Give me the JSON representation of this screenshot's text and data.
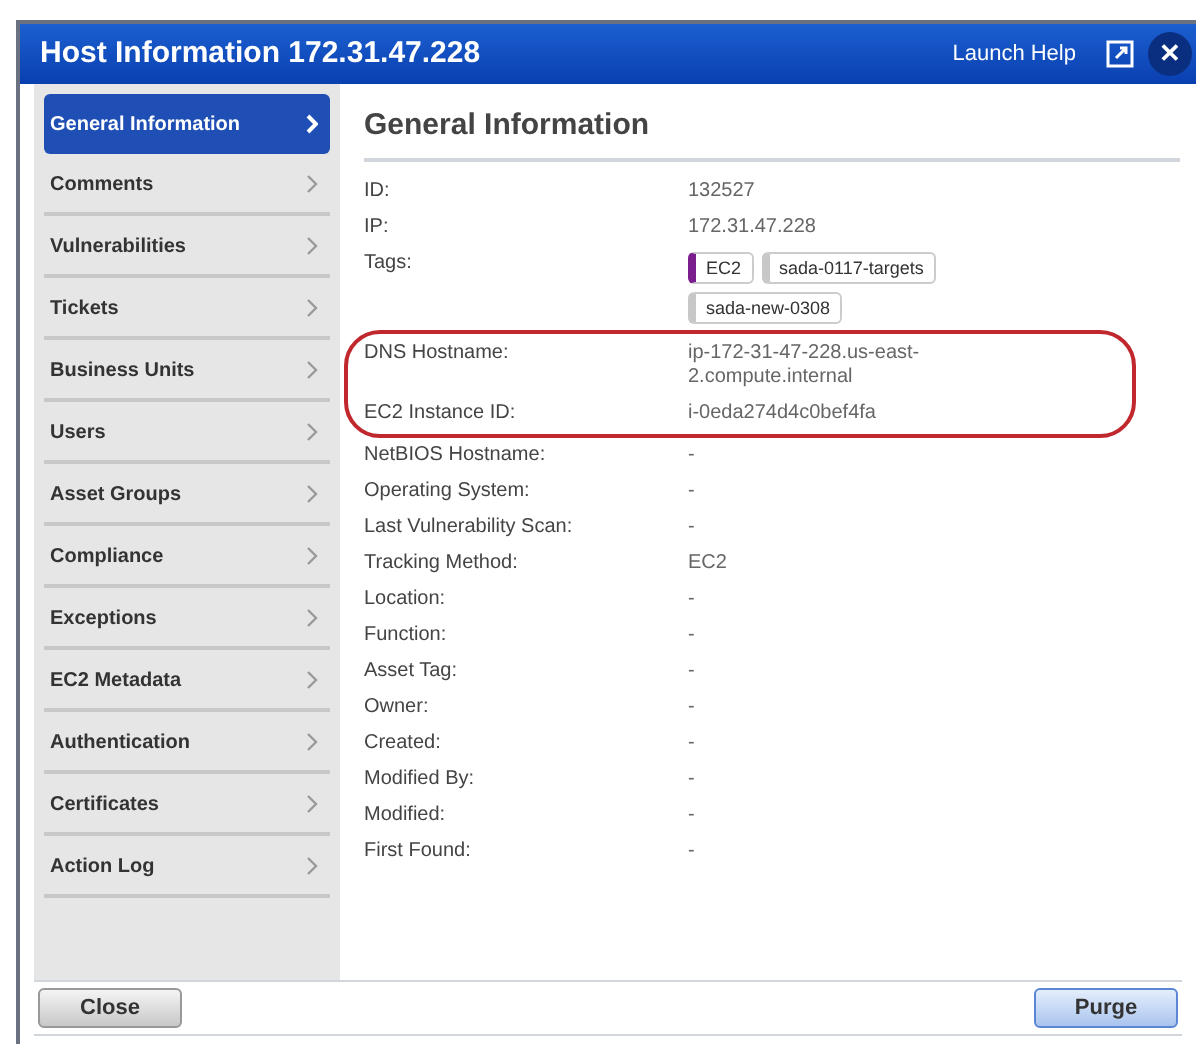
{
  "window": {
    "title": "Host Information 172.31.47.228",
    "help_link": "Launch Help",
    "close_glyph": "✕"
  },
  "sidebar": {
    "items": [
      {
        "label": "General Information",
        "selected": true
      },
      {
        "label": "Comments",
        "selected": false
      },
      {
        "label": "Vulnerabilities",
        "selected": false
      },
      {
        "label": "Tickets",
        "selected": false
      },
      {
        "label": "Business Units",
        "selected": false
      },
      {
        "label": "Users",
        "selected": false
      },
      {
        "label": "Asset Groups",
        "selected": false
      },
      {
        "label": "Compliance",
        "selected": false
      },
      {
        "label": "Exceptions",
        "selected": false
      },
      {
        "label": "EC2 Metadata",
        "selected": false
      },
      {
        "label": "Authentication",
        "selected": false
      },
      {
        "label": "Certificates",
        "selected": false
      },
      {
        "label": "Action Log",
        "selected": false
      }
    ]
  },
  "section": {
    "title": "General Information",
    "fields": [
      {
        "kind": "text",
        "label": "ID:",
        "value": "132527",
        "highlighted": false
      },
      {
        "kind": "text",
        "label": "IP:",
        "value": "172.31.47.228",
        "highlighted": false
      },
      {
        "kind": "tags",
        "label": "Tags:",
        "tags": [
          {
            "label": "EC2",
            "color": "#7b1f8f"
          },
          {
            "label": "sada-0117-targets",
            "color": "#c8c8c8"
          },
          {
            "label": "sada-new-0308",
            "color": "#c8c8c8"
          }
        ],
        "highlighted": false
      },
      {
        "kind": "text",
        "label": "DNS Hostname:",
        "value": "ip-172-31-47-228.us-east-2.compute.internal",
        "highlighted": true
      },
      {
        "kind": "text",
        "label": "EC2 Instance ID:",
        "value": "i-0eda274d4c0bef4fa",
        "highlighted": true
      },
      {
        "kind": "text",
        "label": "NetBIOS Hostname:",
        "value": "-",
        "highlighted": false
      },
      {
        "kind": "text",
        "label": "Operating System:",
        "value": "-",
        "highlighted": false
      },
      {
        "kind": "text",
        "label": "Last Vulnerability Scan:",
        "value": "-",
        "highlighted": false
      },
      {
        "kind": "text",
        "label": "Tracking Method:",
        "value": "EC2",
        "highlighted": false
      },
      {
        "kind": "text",
        "label": "Location:",
        "value": "-",
        "highlighted": false
      },
      {
        "kind": "text",
        "label": "Function:",
        "value": "-",
        "highlighted": false
      },
      {
        "kind": "text",
        "label": "Asset Tag:",
        "value": "-",
        "highlighted": false
      },
      {
        "kind": "text",
        "label": "Owner:",
        "value": "-",
        "highlighted": false
      },
      {
        "kind": "text",
        "label": "Created:",
        "value": "-",
        "highlighted": false
      },
      {
        "kind": "text",
        "label": "Modified By:",
        "value": "-",
        "highlighted": false
      },
      {
        "kind": "text",
        "label": "Modified:",
        "value": "-",
        "highlighted": false
      },
      {
        "kind": "text",
        "label": "First Found:",
        "value": "-",
        "highlighted": false
      }
    ]
  },
  "buttons": [
    {
      "label": "Close",
      "kind": "secondary"
    },
    {
      "label": "Purge",
      "kind": "primary"
    }
  ]
}
